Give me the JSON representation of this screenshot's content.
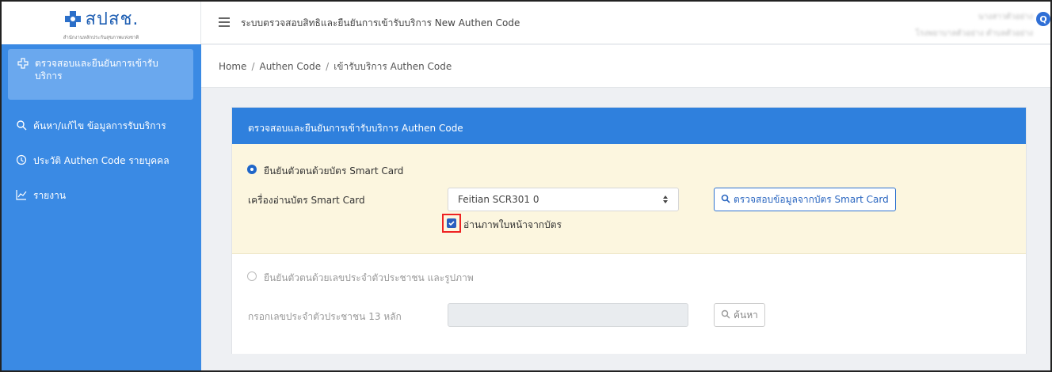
{
  "brand": {
    "logo_text": "สปสช.",
    "logo_sub": "สำนักงานหลักประกันสุขภาพแห่งชาติ"
  },
  "header": {
    "app_title": "ระบบตรวจสอบสิทธิและยืนยันการเข้ารับบริการ New Authen Code",
    "user_name": "นางสาวตัวอย่าง",
    "user_org": "โรงพยาบาลตัวอย่าง ตำบลตัวอย่าง",
    "avatar_letter": "Q"
  },
  "sidebar": {
    "items": [
      {
        "label": "ตรวจสอบและยืนยันการเข้ารับบริการ",
        "icon": "plus-cross-icon"
      },
      {
        "label": "ค้นหา/แก้ไข ข้อมูลการรับบริการ",
        "icon": "search-icon"
      },
      {
        "label": "ประวัติ Authen Code รายบุคคล",
        "icon": "history-icon"
      },
      {
        "label": "รายงาน",
        "icon": "chart-icon"
      }
    ]
  },
  "breadcrumb": {
    "home": "Home",
    "level1": "Authen Code",
    "level2": "เข้ารับบริการ Authen Code"
  },
  "card": {
    "title": "ตรวจสอบและยืนยันการเข้ารับบริการ Authen Code",
    "smartcard": {
      "radio_label": "ยืนยันตัวตนด้วยบัตร Smart Card",
      "reader_label": "เครื่องอ่านบัตร Smart Card",
      "reader_value": "Feitian SCR301 0",
      "check_button": "ตรวจสอบข้อมูลจากบัตร Smart Card",
      "checkbox_label": "อ่านภาพใบหน้าจากบัตร",
      "checkbox_checked": true
    },
    "citizen": {
      "radio_label": "ยืนยันตัวตนด้วยเลขประจำตัวประชาชน และรูปภาพ",
      "id_label": "กรอกเลขประจำตัวประชาชน 13 หลัก",
      "id_value": "",
      "search_button": "ค้นหา"
    }
  },
  "colors": {
    "sidebar": "#3a8ae4",
    "card_header": "#2f80dd",
    "highlight": "#e22222"
  }
}
